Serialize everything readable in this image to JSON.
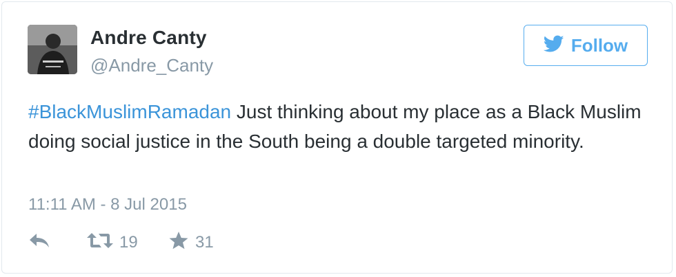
{
  "author": {
    "display_name": "Andre Canty",
    "screen_name": "@Andre_Canty"
  },
  "follow_button": {
    "label": "Follow",
    "icon": "twitter-bird-icon",
    "color": "#55acee"
  },
  "tweet": {
    "hashtag": "#BlackMuslimRamadan",
    "text": " Just thinking about my place as a Black Muslim doing social justice in the South being a double targeted  minority.",
    "timestamp": "11:11 AM - 8 Jul 2015"
  },
  "actions": {
    "reply": {
      "icon": "reply-icon"
    },
    "retweet": {
      "icon": "retweet-icon",
      "count": "19"
    },
    "favorite": {
      "icon": "star-icon",
      "count": "31"
    }
  },
  "colors": {
    "text": "#292f33",
    "muted": "#8899a6",
    "link": "#3b94d9",
    "border": "#e1e8ed"
  }
}
